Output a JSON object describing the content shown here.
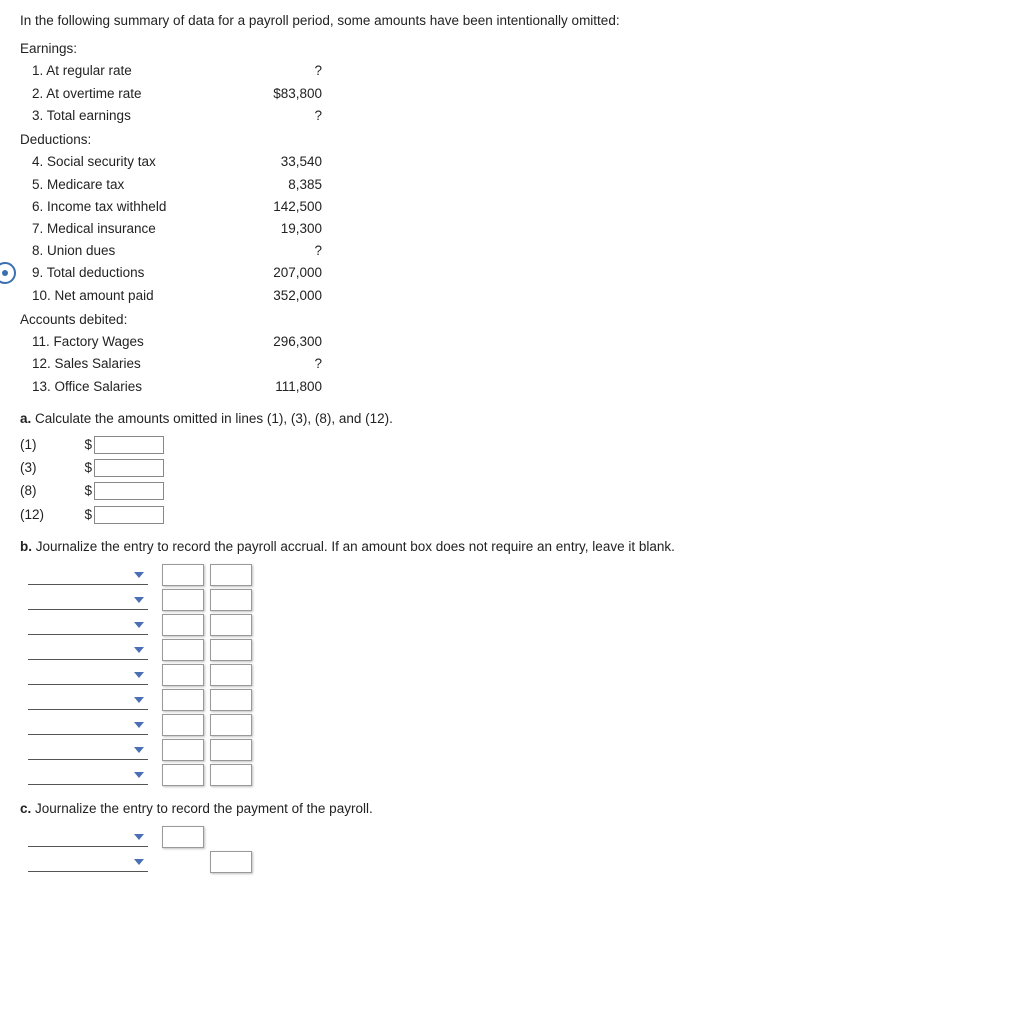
{
  "intro": "In the following summary of data for a payroll period, some amounts have been intentionally omitted:",
  "sections": {
    "earnings_label": "Earnings:",
    "deductions_label": "Deductions:",
    "accounts_label": "Accounts debited:"
  },
  "rows": {
    "r1": {
      "label": "1. At regular rate",
      "value": "?"
    },
    "r2": {
      "label": "2. At overtime rate",
      "value": "$83,800"
    },
    "r3": {
      "label": "3. Total earnings",
      "value": "?"
    },
    "r4": {
      "label": "4. Social security tax",
      "value": "33,540"
    },
    "r5": {
      "label": "5. Medicare tax",
      "value": "8,385"
    },
    "r6": {
      "label": "6. Income tax withheld",
      "value": "142,500"
    },
    "r7": {
      "label": "7. Medical insurance",
      "value": "19,300"
    },
    "r8": {
      "label": "8. Union dues",
      "value": "?"
    },
    "r9": {
      "label": "9. Total deductions",
      "value": "207,000"
    },
    "r10": {
      "label": "10. Net amount paid",
      "value": "352,000"
    },
    "r11": {
      "label": "11. Factory Wages",
      "value": "296,300"
    },
    "r12": {
      "label": "12. Sales Salaries",
      "value": "?"
    },
    "r13": {
      "label": "13. Office Salaries",
      "value": "111,800"
    }
  },
  "part_a": {
    "prompt_bold": "a.",
    "prompt_rest": "  Calculate the amounts omitted in lines (1), (3), (8), and (12).",
    "items": [
      {
        "tag": "(1)",
        "sym": "$"
      },
      {
        "tag": "(3)",
        "sym": "$"
      },
      {
        "tag": "(8)",
        "sym": "$"
      },
      {
        "tag": "(12)",
        "sym": "$"
      }
    ]
  },
  "part_b": {
    "prompt_bold": "b.",
    "prompt_rest": "  Journalize the entry to record the payroll accrual. If an amount box does not require an entry, leave it blank.",
    "row_count": 9
  },
  "part_c": {
    "prompt_bold": "c.",
    "prompt_rest": "  Journalize the entry to record the payment of the payroll.",
    "row_count": 2
  }
}
